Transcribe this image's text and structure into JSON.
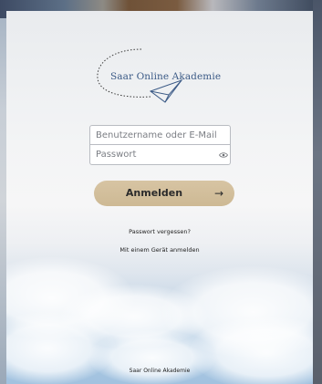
{
  "logo": {
    "title": "Saar Online Akademie",
    "icon": "paper-plane-icon"
  },
  "form": {
    "username_placeholder": "Benutzername oder E-Mail",
    "username_value": "",
    "password_placeholder": "Passwort",
    "password_value": "",
    "reveal_icon": "eye-icon"
  },
  "actions": {
    "login_label": "Anmelden",
    "login_icon": "→",
    "forgot_password": "Passwort vergessen?",
    "device_login": "Mit einem Gerät anmelden"
  },
  "footer": {
    "text": "Saar Online Akademie"
  },
  "colors": {
    "accent_button": "#d1bd99",
    "logo_text": "#3b5a86",
    "sky": "#a7c6e2"
  }
}
